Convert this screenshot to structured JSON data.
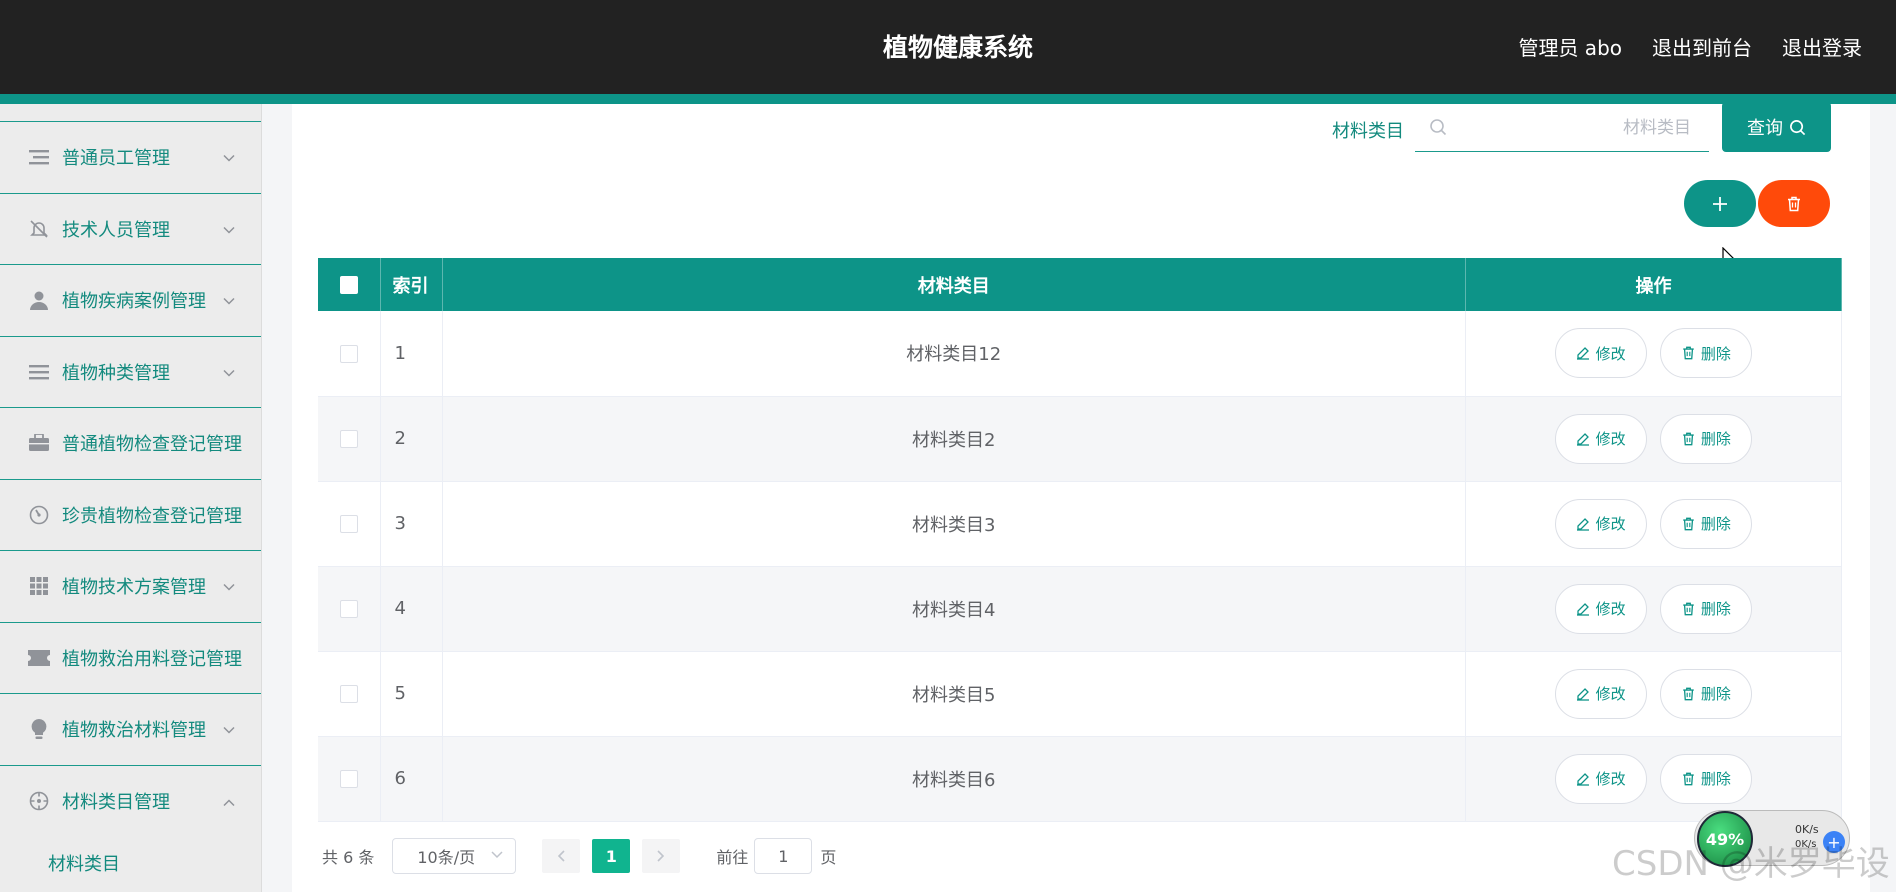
{
  "header": {
    "title": "植物健康系统",
    "admin": "管理员 abo",
    "to_front": "退出到前台",
    "logout": "退出登录"
  },
  "sidebar": {
    "items": [
      {
        "label": "普通员工管理",
        "icon": "list-icon",
        "caret": true
      },
      {
        "label": "技术人员管理",
        "icon": "bell-off-icon",
        "caret": true
      },
      {
        "label": "植物疾病案例管理",
        "icon": "user-icon",
        "caret": true
      },
      {
        "label": "植物种类管理",
        "icon": "menu-icon",
        "caret": true
      },
      {
        "label": "普通植物检查登记管理",
        "icon": "briefcase-icon",
        "caret": false
      },
      {
        "label": "珍贵植物检查登记管理",
        "icon": "gauge-icon",
        "caret": false
      },
      {
        "label": "植物技术方案管理",
        "icon": "grid-icon",
        "caret": true
      },
      {
        "label": "植物救治用料登记管理",
        "icon": "ticket-icon",
        "caret": false
      },
      {
        "label": "植物救治材料管理",
        "icon": "bulb-icon",
        "caret": true
      },
      {
        "label": "材料类目管理",
        "icon": "compass-icon",
        "caret": true,
        "expanded": true
      }
    ],
    "sub_item": "材料类目"
  },
  "search": {
    "label": "材料类目",
    "placeholder": "材料类目",
    "button": "查询"
  },
  "table": {
    "headers": {
      "index": "索引",
      "name": "材料类目",
      "ops": "操作"
    },
    "rows": [
      {
        "index": "1",
        "name": "材料类目12"
      },
      {
        "index": "2",
        "name": "材料类目2"
      },
      {
        "index": "3",
        "name": "材料类目3"
      },
      {
        "index": "4",
        "name": "材料类目4"
      },
      {
        "index": "5",
        "name": "材料类目5"
      },
      {
        "index": "6",
        "name": "材料类目6"
      }
    ],
    "edit_label": "修改",
    "delete_label": "删除"
  },
  "pager": {
    "total": "共 6 条",
    "page_size": "10条/页",
    "current": "1",
    "jump_prefix": "前往",
    "jump_value": "1",
    "jump_suffix": "页"
  },
  "widget": {
    "percent": "49%",
    "speed": "0K/s",
    "speed2": "0K/s"
  },
  "watermark": "CSDN @米罗毕设",
  "colors": {
    "accent": "#0d9488",
    "danger": "#ff4a0a",
    "header_bg": "#222222"
  }
}
